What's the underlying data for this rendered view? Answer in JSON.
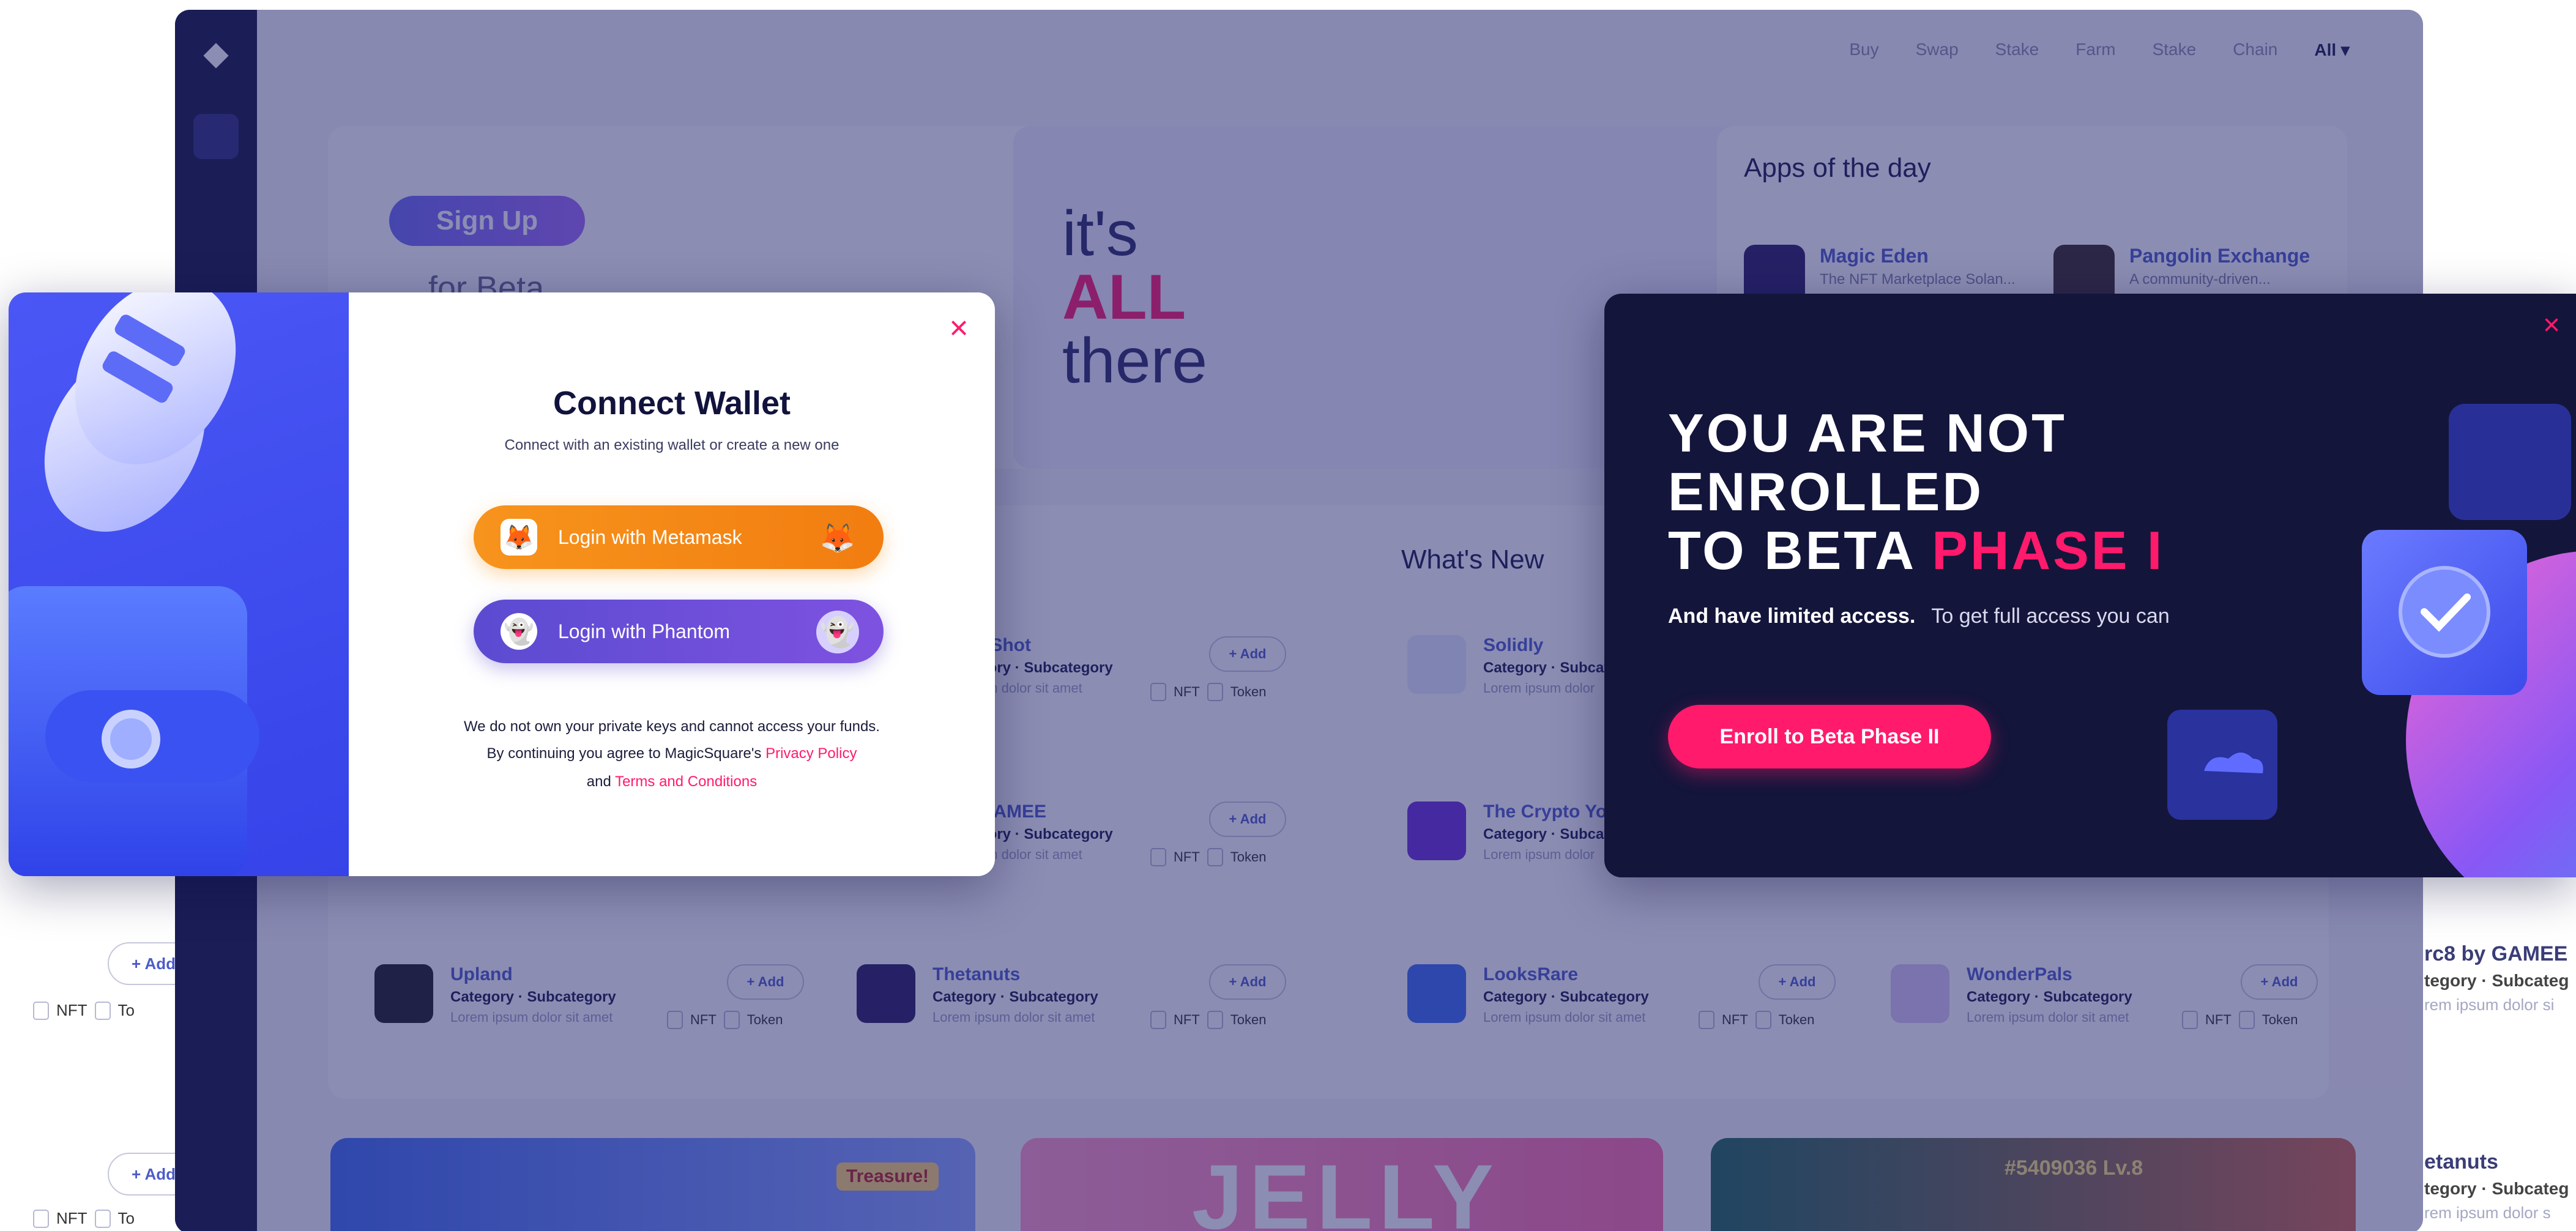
{
  "background": {
    "topbar_filters": [
      "Buy",
      "Swap",
      "Stake",
      "Farm",
      "Stake"
    ],
    "chain_label": "Chain",
    "chain_value": "All",
    "signup_label": "Sign Up",
    "for_beta": "for Beta",
    "itsall_1": "it's",
    "itsall_2": "ALL",
    "itsall_3": "there",
    "apps_of_day_title": "Apps of the day",
    "apps_of_day": [
      {
        "name": "Magic Eden",
        "desc": "The NFT Marketplace Solan..."
      },
      {
        "name": "Pangolin Exchange",
        "desc": "A community-driven..."
      }
    ],
    "whats_new_title": "What's New",
    "items": [
      {
        "name": "Solidly",
        "cat": "Category · Subcategory",
        "desc": "Lorem ipsum dolor"
      },
      {
        "name": "The Crypto Yo",
        "cat": "Category · Subcategory",
        "desc": "Lorem ipsum dolor"
      },
      {
        "name": "LooksRare",
        "cat": "Category · Subcategory",
        "desc": "Lorem ipsum dolor sit amet"
      },
      {
        "name": "WonderPals",
        "cat": "Category · Subcategory",
        "desc": "Lorem ipsum dolor sit amet"
      },
      {
        "name": "Upland",
        "cat": "Category · Subcategory",
        "desc": "Lorem ipsum dolor sit amet"
      },
      {
        "name": "Thetanuts",
        "cat": "Category · Subcategory",
        "desc": "Lorem ipsum dolor sit amet"
      },
      {
        "name": "pShot",
        "cat": "gory · Subcategory",
        "desc": "um dolor sit amet"
      },
      {
        "name": "GAMEE",
        "cat": "gory · Subcategory",
        "desc": "um dolor sit amet"
      }
    ],
    "add_label": "+ Add",
    "add_peek": "+ Add",
    "nft_label": "NFT",
    "token_label": "Token",
    "token_peek": "To",
    "right_peek_1": {
      "name": "rc8 by GAMEE",
      "cat": "tegory · Subcateg",
      "desc": "rem ipsum dolor si"
    },
    "right_peek_2": {
      "name": "etanuts",
      "cat": "tegory · Subcateg",
      "desc": "rem ipsum dolor s"
    },
    "banner_text": "JELLY",
    "banner_treasure": "Treasure!",
    "banner_id": "#5409036 Lv.8"
  },
  "connect_wallet": {
    "title": "Connect Wallet",
    "subtitle": "Connect with an existing wallet or create a new one",
    "metamask_label": "Login with Metamask",
    "phantom_label": "Login with Phantom",
    "footer_line1": "We do not own your private keys and cannot access your funds.",
    "footer_line2_prefix": "By continuing you agree to MagicSquare's",
    "privacy_link": "Privacy Policy",
    "footer_line3_prefix": "and",
    "terms_link": "Terms and Conditions",
    "close_glyph": "×"
  },
  "beta_modal": {
    "heading_line1": "YOU ARE NOT",
    "heading_line2": "ENROLLED",
    "heading_line3": "TO BETA",
    "heading_highlight": "PHASE I",
    "desc_bold": "And have limited access.",
    "desc_light": "To get full access you can",
    "enroll_label": "Enroll to Beta Phase II",
    "close_glyph": "×"
  },
  "colors": {
    "accent_pink": "#ff1a6c",
    "metamask_orange": "#f7941d",
    "phantom_purple": "#6a4fd8",
    "wallet_blue": "#3f4cf0",
    "beta_bg": "#14153b"
  },
  "icons": {
    "metamask": "fox-icon",
    "phantom": "ghost-icon",
    "close": "close-icon"
  }
}
